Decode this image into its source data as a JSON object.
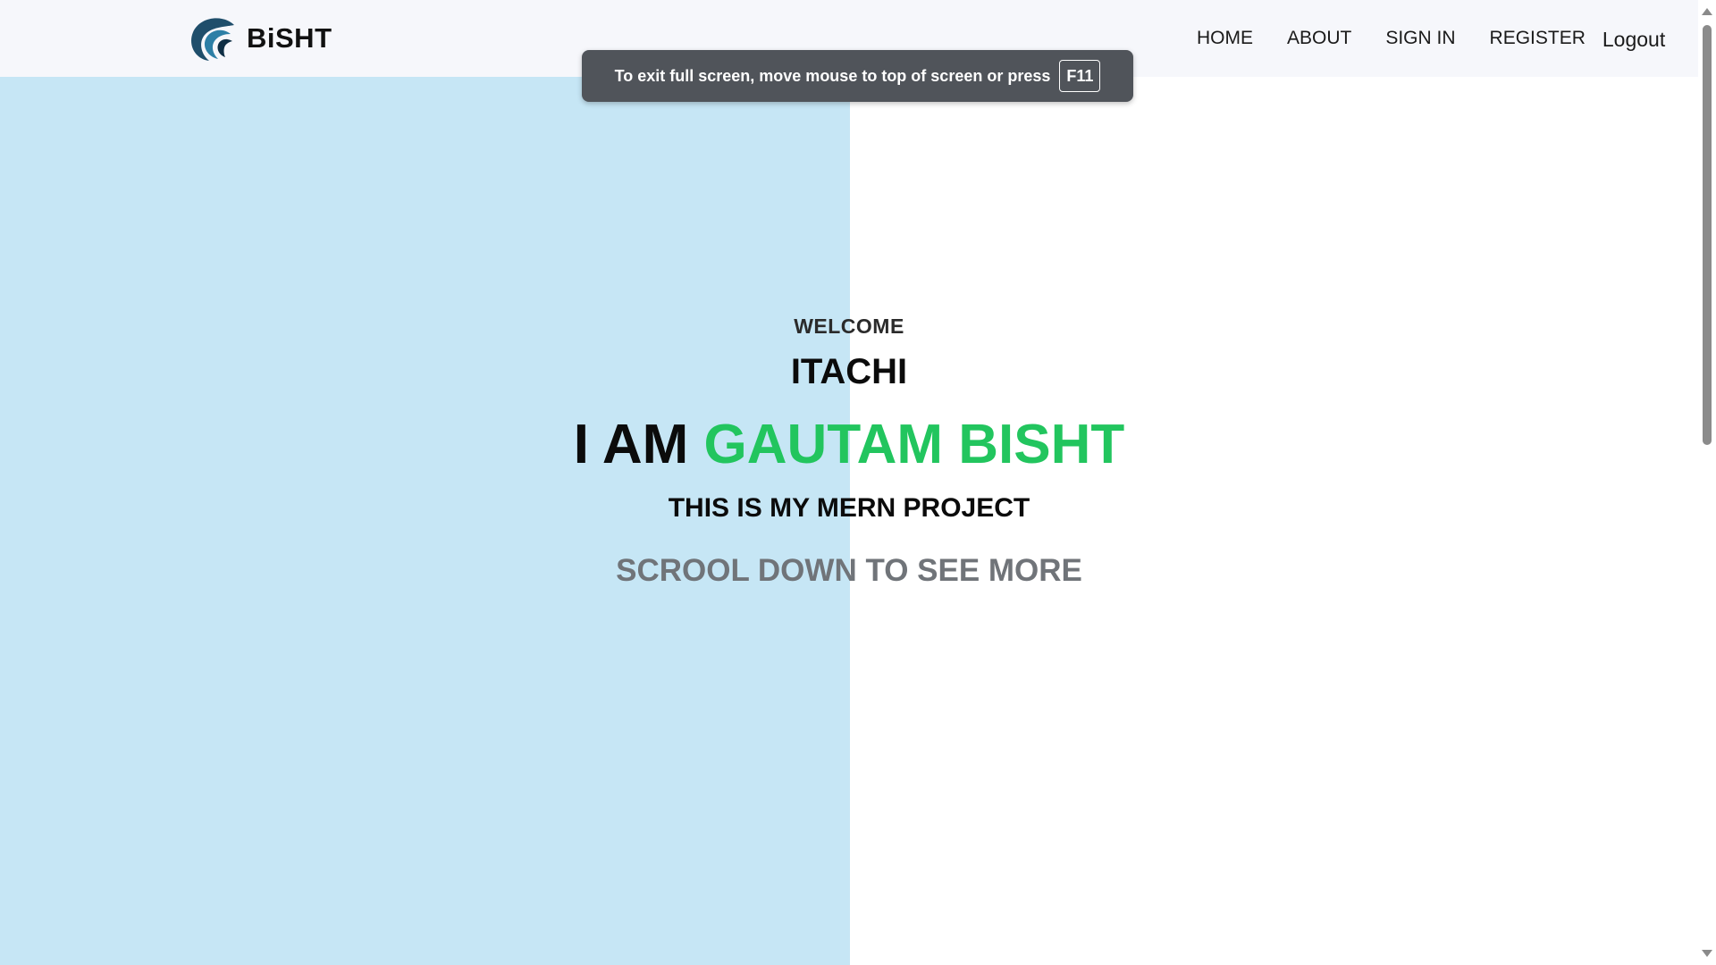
{
  "navbar": {
    "brand_name": "BiSHT",
    "brand_icon": "wave-logo-icon",
    "links": {
      "home": "HOME",
      "about": "ABOUT",
      "signin": "SIGN IN",
      "register": "REGISTER",
      "logout": "Logout"
    }
  },
  "toast": {
    "text": "To exit full screen, move mouse to top of screen or press",
    "key": "F11"
  },
  "hero": {
    "welcome": "WELCOME",
    "username": "ITACHI",
    "intro_prefix": "I AM",
    "intro_name": "GAUTAM BISHT",
    "project": "THIS IS MY MERN PROJECT",
    "scroll_hint": "SCROOL DOWN TO SEE MORE"
  },
  "colors": {
    "left_panel": "#c6e6f5",
    "accent_green": "#22c55e",
    "navbar_bg": "#f6f7fb",
    "toast_bg": "#50545a",
    "scroll_hint": "#707479"
  }
}
